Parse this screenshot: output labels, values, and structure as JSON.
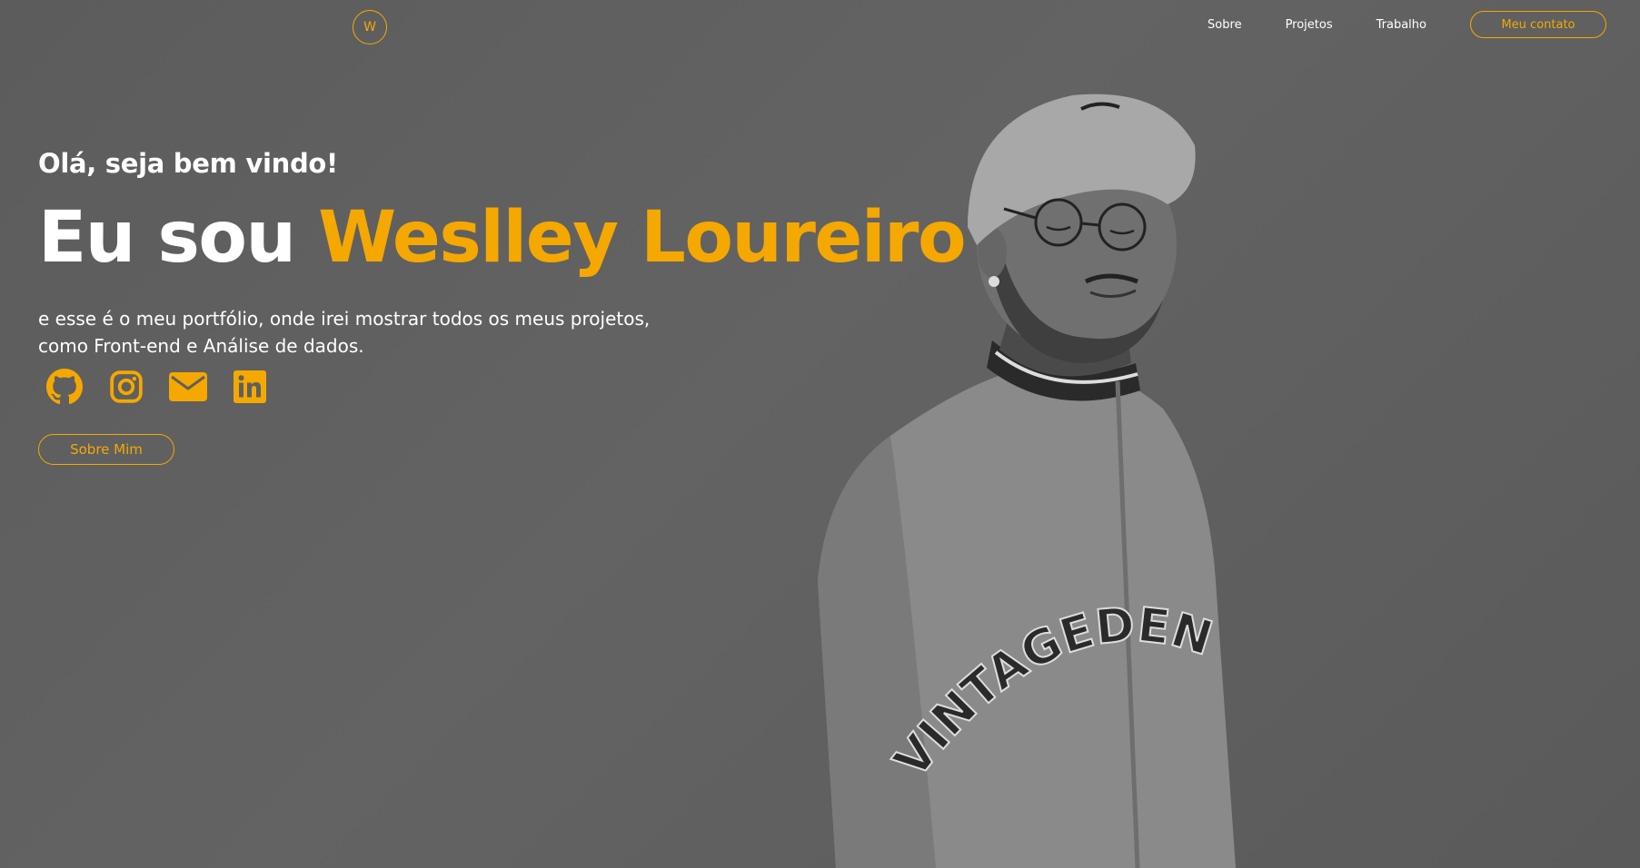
{
  "header": {
    "logo_letter": "W",
    "nav": {
      "about": "Sobre",
      "projects": "Projetos",
      "work": "Trabalho"
    },
    "contact_button": "Meu contato"
  },
  "hero": {
    "greeting": "Olá, seja bem vindo!",
    "headline_prefix": "Eu sou ",
    "headline_name": "Weslley Loureiro",
    "description_line1": "e esse é o meu portfólio, onde irei mostrar todos os meus projetos,",
    "description_line2": "como Front-end e Análise de dados.",
    "socials": [
      "github-icon",
      "instagram-icon",
      "mail-icon",
      "linkedin-icon"
    ],
    "about_button": "Sobre Mim",
    "portrait_shirt_text": "VINTAGEDEN"
  },
  "colors": {
    "background": "#5f5f5f",
    "accent": "#f5a800",
    "text": "#ffffff"
  }
}
